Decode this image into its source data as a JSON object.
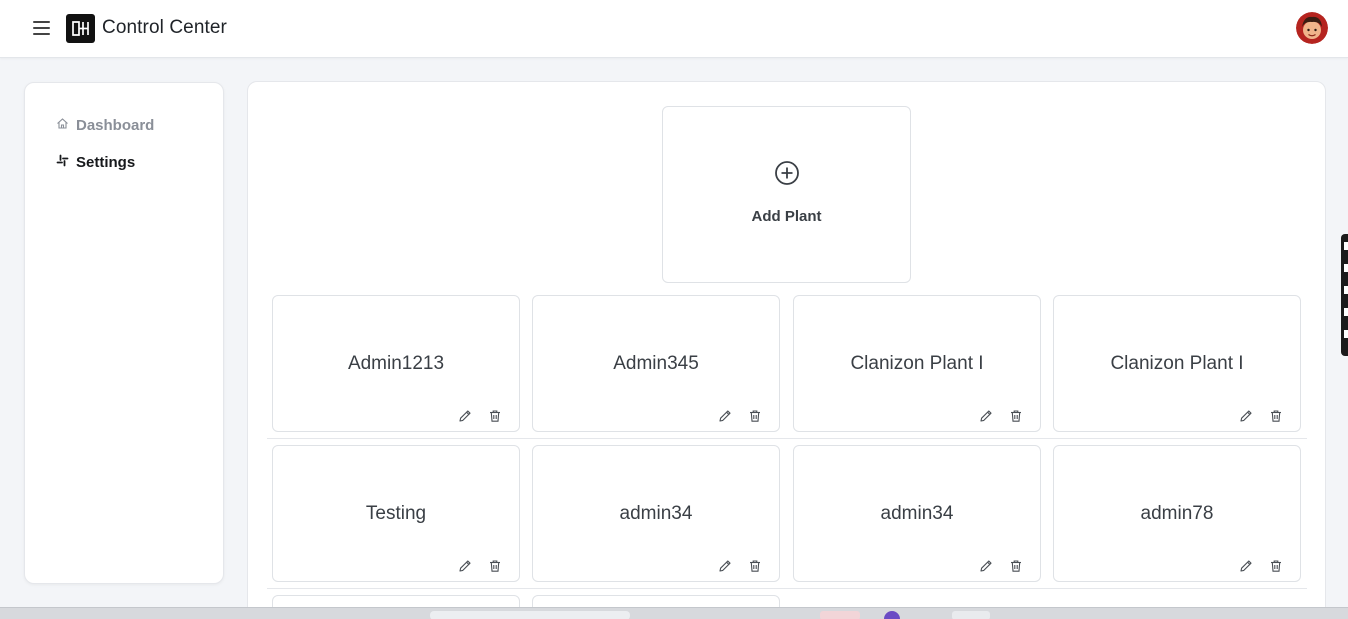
{
  "header": {
    "title": "Control Center",
    "menu_icon": "hamburger-menu-icon",
    "logo_icon": "brand-logo-icon",
    "avatar": "user-avatar"
  },
  "sidebar": {
    "items": [
      {
        "label": "Dashboard",
        "icon": "home-icon",
        "active": false
      },
      {
        "label": "Settings",
        "icon": "settings-grid-icon",
        "active": true
      }
    ]
  },
  "main": {
    "add_card": {
      "label": "Add Plant",
      "icon": "plus-circle-icon"
    },
    "plants": [
      {
        "name": "Admin1213"
      },
      {
        "name": "Admin345"
      },
      {
        "name": "Clanizon Plant I"
      },
      {
        "name": "Clanizon Plant I"
      },
      {
        "name": "Testing"
      },
      {
        "name": "admin34"
      },
      {
        "name": "admin34"
      },
      {
        "name": "admin78"
      }
    ],
    "card_actions": {
      "edit_icon": "pencil-icon",
      "delete_icon": "trash-icon"
    }
  },
  "colors": {
    "page_bg": "#f3f5f8",
    "card_border": "#dfe2e6",
    "active_nav": "#17191c",
    "inactive_nav": "#8a8f98"
  }
}
